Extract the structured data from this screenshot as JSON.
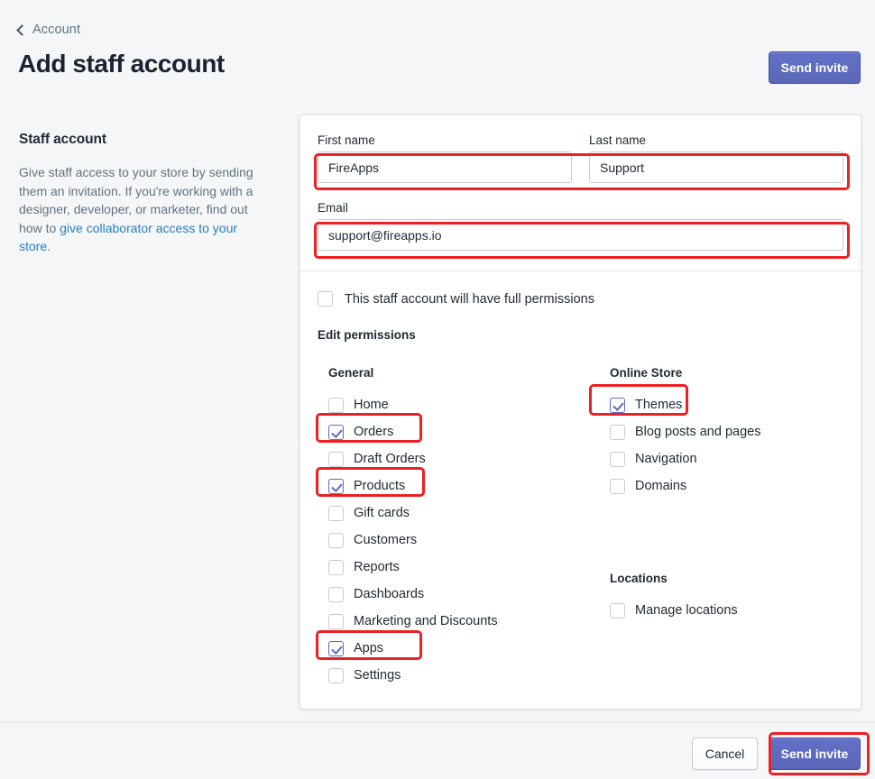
{
  "header": {
    "back_label": "Account",
    "back_icon": "chevron-left-icon",
    "title": "Add staff account",
    "primary_action": "Send invite"
  },
  "aside": {
    "title": "Staff account",
    "text_part1": "Give staff access to your store by sending them an invitation. If you're working with a designer, developer, or marketer, find out how to ",
    "link_text": "give collaborator access to your store",
    "text_part2": "."
  },
  "form": {
    "first_name": {
      "label": "First name",
      "value": "FireApps",
      "placeholder": ""
    },
    "last_name": {
      "label": "Last name",
      "value": "Support",
      "placeholder": ""
    },
    "email": {
      "label": "Email",
      "value": "support@fireapps.io",
      "placeholder": ""
    }
  },
  "permissions": {
    "full_permissions_label": "This staff account will have full permissions",
    "full_permissions_checked": false,
    "edit_permissions_title": "Edit permissions",
    "groups": [
      {
        "title": "General",
        "items": [
          {
            "label": "Home",
            "checked": false
          },
          {
            "label": "Orders",
            "checked": true
          },
          {
            "label": "Draft Orders",
            "checked": false
          },
          {
            "label": "Products",
            "checked": true
          },
          {
            "label": "Gift cards",
            "checked": false
          },
          {
            "label": "Customers",
            "checked": false
          },
          {
            "label": "Reports",
            "checked": false
          },
          {
            "label": "Dashboards",
            "checked": false
          },
          {
            "label": "Marketing and Discounts",
            "checked": false
          },
          {
            "label": "Apps",
            "checked": true
          },
          {
            "label": "Settings",
            "checked": false
          }
        ]
      },
      {
        "title": "Online Store",
        "items": [
          {
            "label": "Themes",
            "checked": true
          },
          {
            "label": "Blog posts and pages",
            "checked": false
          },
          {
            "label": "Navigation",
            "checked": false
          },
          {
            "label": "Domains",
            "checked": false
          }
        ]
      },
      {
        "title": "Locations",
        "items": [
          {
            "label": "Manage locations",
            "checked": false
          }
        ]
      }
    ]
  },
  "footer": {
    "cancel_label": "Cancel",
    "send_label": "Send invite"
  },
  "colors": {
    "page_background": "#f4f6f8",
    "accent_purple": "#5c6ac4",
    "annotation_red": "#ed2024",
    "link_blue": "#2a7fba",
    "text": "#212b36",
    "muted_text": "#637381"
  }
}
